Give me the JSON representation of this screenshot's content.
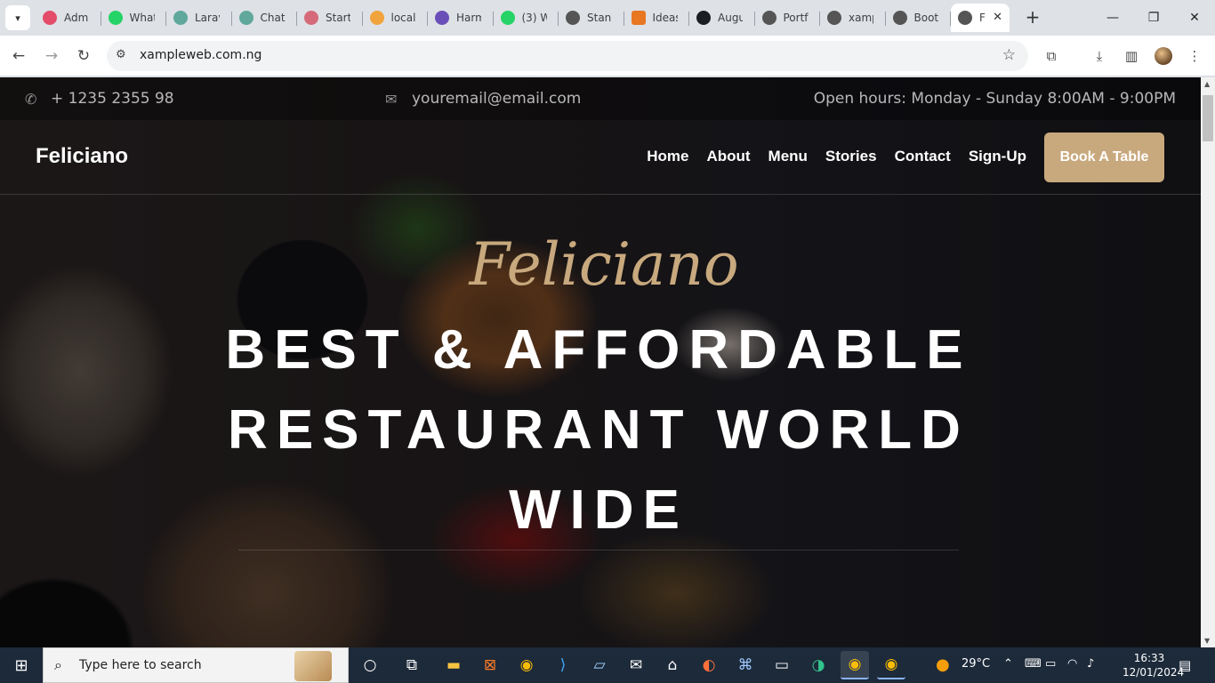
{
  "browser": {
    "tabs": [
      {
        "label": "Admi",
        "color": "#e44d69"
      },
      {
        "label": "What",
        "color": "#25d366"
      },
      {
        "label": "Larav",
        "color": "#5fa89b"
      },
      {
        "label": "Chat",
        "color": "#5fa89b"
      },
      {
        "label": "Start",
        "color": "#d66a7a"
      },
      {
        "label": "local",
        "color": "#f1a43c"
      },
      {
        "label": "Harm",
        "color": "#6b4fb8"
      },
      {
        "label": "(3) W",
        "color": "#25d366"
      },
      {
        "label": "Stanc",
        "color": "#555555"
      },
      {
        "label": "Ideas",
        "color": "#e87722"
      },
      {
        "label": "Augu",
        "color": "#1b1f23"
      },
      {
        "label": "Portf",
        "color": "#555555"
      },
      {
        "label": "xamp",
        "color": "#555555"
      },
      {
        "label": "Boot",
        "color": "#555555"
      },
      {
        "label": "F",
        "color": "#555555",
        "active": true
      }
    ],
    "url": "xampleweb.com.ng"
  },
  "site": {
    "topbar": {
      "phone": "+ 1235 2355 98",
      "email": "youremail@email.com",
      "hours": "Open hours: Monday - Sunday 8:00AM - 9:00PM"
    },
    "brand": "Feliciano",
    "menu": [
      "Home",
      "About",
      "Menu",
      "Stories",
      "Contact",
      "Sign-Up"
    ],
    "cta": "Book A Table",
    "hero": {
      "script": "Feliciano",
      "lines": [
        "BEST & AFFORDABLE",
        "RESTAURANT WORLD",
        "WIDE"
      ]
    },
    "accent": "#c8a97e"
  },
  "taskbar": {
    "search_placeholder": "Type here to search",
    "weather": "29°C",
    "time": "16:33",
    "date": "12/01/2024"
  }
}
